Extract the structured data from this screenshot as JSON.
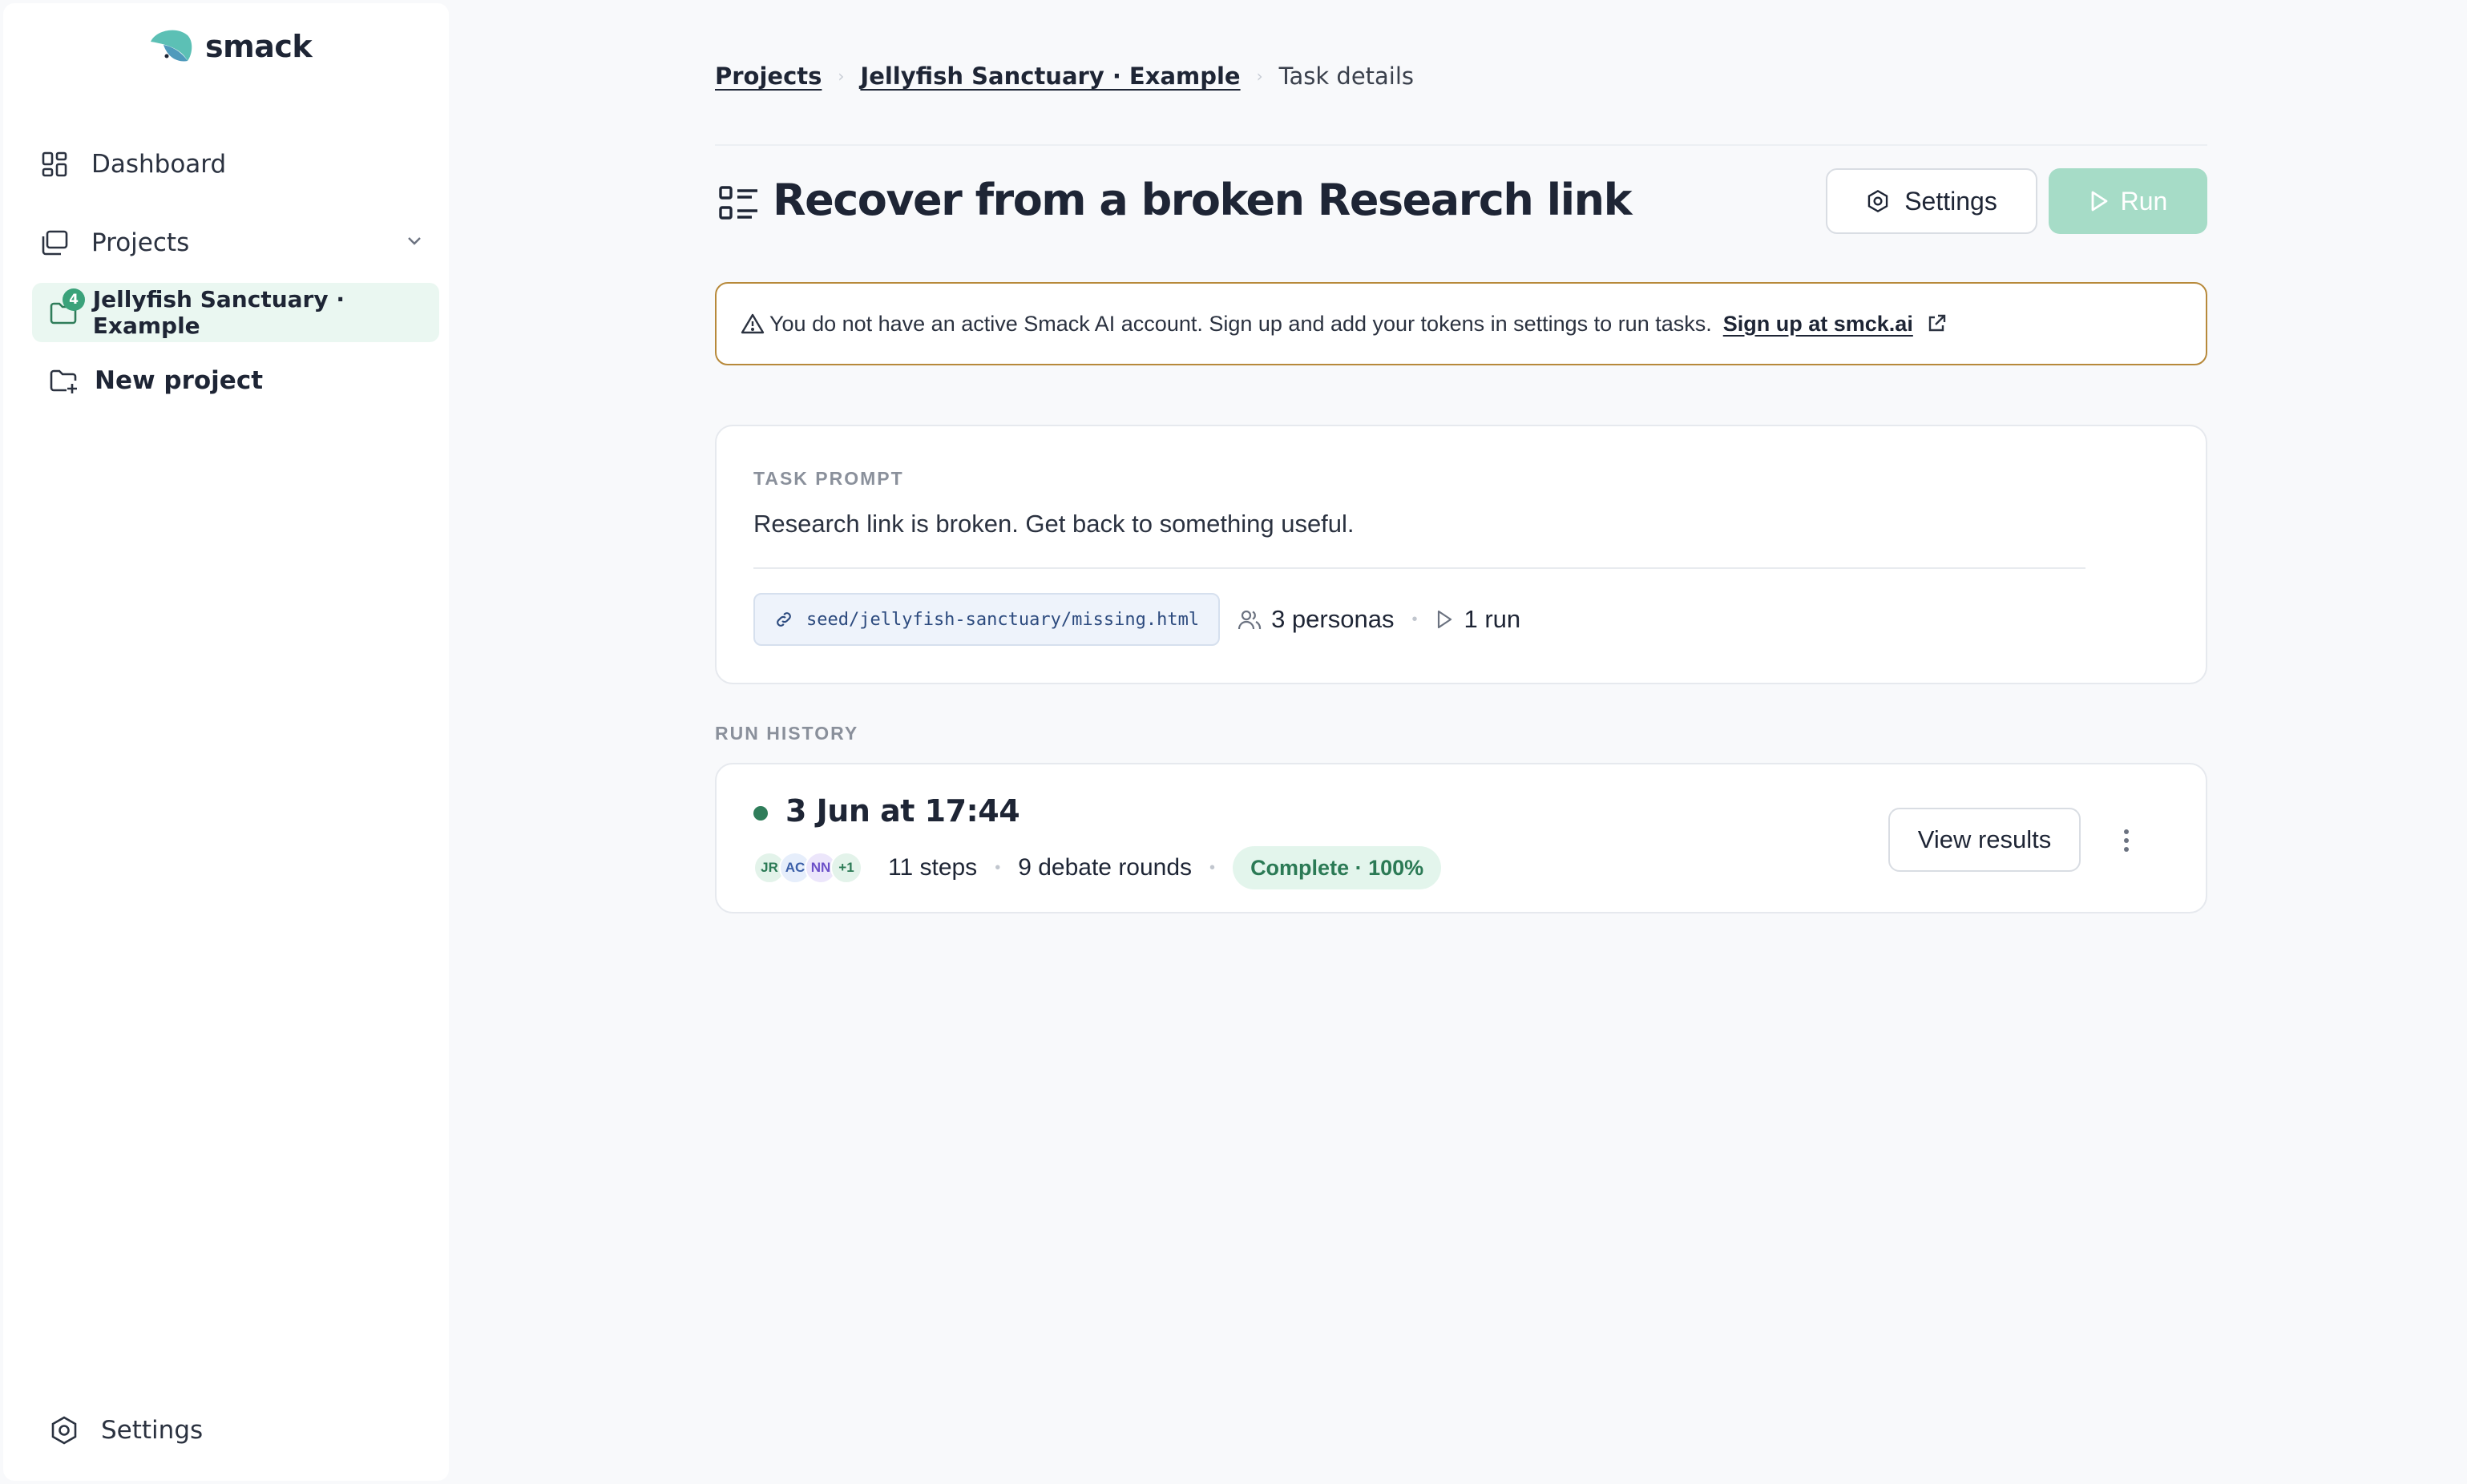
{
  "app": {
    "name": "smack"
  },
  "sidebar": {
    "dashboard_label": "Dashboard",
    "projects_label": "Projects",
    "active_project": {
      "label": "Jellyfish Sanctuary · Example",
      "badge": "4"
    },
    "new_project_label": "New project",
    "settings_label": "Settings"
  },
  "breadcrumb": {
    "projects": "Projects",
    "project": "Jellyfish Sanctuary · Example",
    "current": "Task details"
  },
  "header": {
    "title": "Recover from a broken Research link",
    "settings_label": "Settings",
    "run_label": "Run"
  },
  "alert": {
    "message": "You do not have an active Smack AI account. Sign up and add your tokens in settings to run tasks.",
    "link_label": "Sign up at smck.ai"
  },
  "task_prompt": {
    "label": "TASK PROMPT",
    "text": "Research link is broken. Get back to something useful.",
    "url": "seed/jellyfish-sanctuary/missing.html",
    "personas": "3 personas",
    "runs": "1 run"
  },
  "run_history": {
    "label": "RUN HISTORY",
    "runs": [
      {
        "date": "3 Jun at 17:44",
        "avatars": [
          "JR",
          "AC",
          "NN",
          "+1"
        ],
        "steps": "11 steps",
        "rounds": "9 debate rounds",
        "status": "Complete · 100%",
        "view_label": "View results"
      }
    ]
  },
  "colors": {
    "accent": "#3aa27a",
    "run_button": "#a6dcc7",
    "alert_border": "#b7893a",
    "active_nav_bg": "#eaf7f1"
  }
}
